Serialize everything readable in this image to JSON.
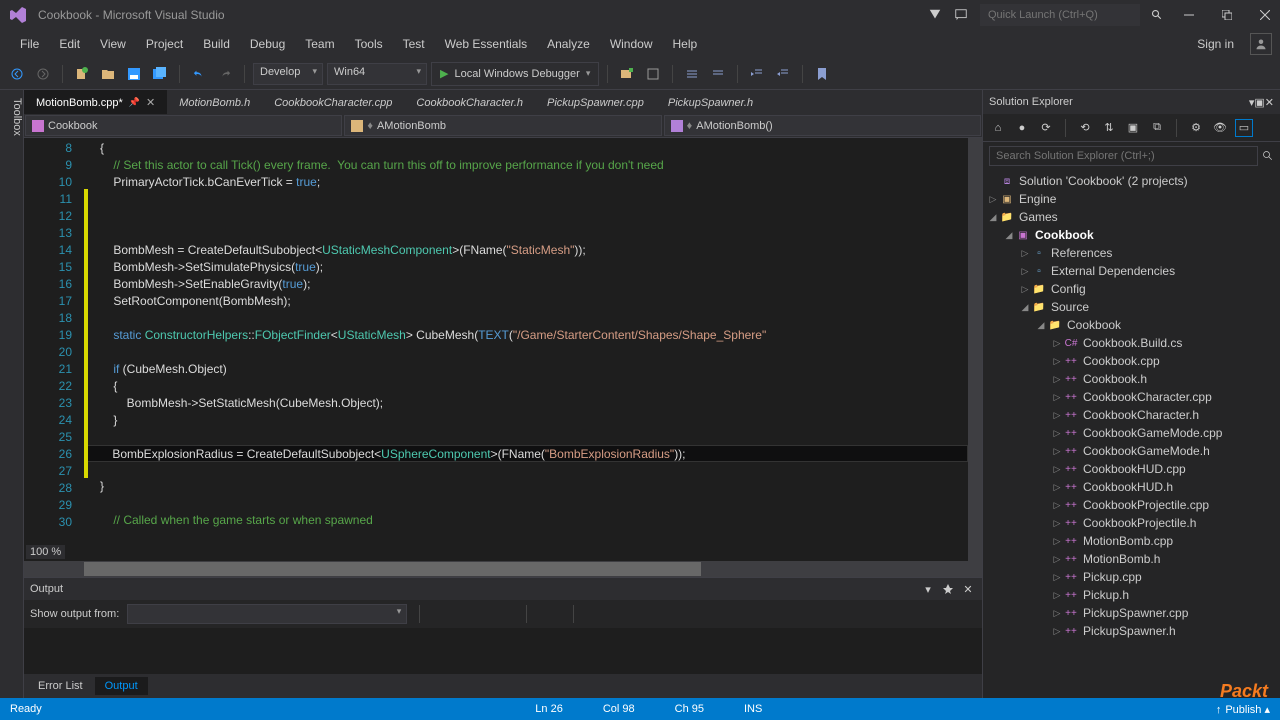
{
  "title": "Cookbook - Microsoft Visual Studio",
  "quickLaunch": {
    "placeholder": "Quick Launch (Ctrl+Q)"
  },
  "signIn": "Sign in",
  "menu": [
    "File",
    "Edit",
    "View",
    "Project",
    "Build",
    "Debug",
    "Team",
    "Tools",
    "Test",
    "Web Essentials",
    "Analyze",
    "Window",
    "Help"
  ],
  "toolbar": {
    "config": "Develop",
    "platform": "Win64",
    "debuggerLabel": "Local Windows Debugger"
  },
  "tabs": [
    {
      "name": "MotionBomb.cpp*",
      "active": true,
      "pinned": true
    },
    {
      "name": "MotionBomb.h",
      "preview": true
    },
    {
      "name": "CookbookCharacter.cpp",
      "preview": true
    },
    {
      "name": "CookbookCharacter.h",
      "preview": true
    },
    {
      "name": "PickupSpawner.cpp",
      "preview": true
    },
    {
      "name": "PickupSpawner.h",
      "preview": true
    }
  ],
  "context": {
    "scope": "Cookbook",
    "class": "AMotionBomb",
    "member": "AMotionBomb()"
  },
  "code": {
    "startLine": 8,
    "endLine": 30,
    "lines": [
      {
        "n": 8,
        "t": "open",
        "txt": "{"
      },
      {
        "n": 9,
        "t": "cmt",
        "txt": "    // Set this actor to call Tick() every frame.  You can turn this off to improve performance if you don't need"
      },
      {
        "n": 10,
        "t": "code",
        "txt": "    PrimaryActorTick.bCanEverTick = ",
        "kw": "true",
        "tail": ";"
      },
      {
        "n": 11,
        "t": "blank",
        "txt": ""
      },
      {
        "n": 12,
        "t": "blank",
        "txt": ""
      },
      {
        "n": 13,
        "t": "blank",
        "txt": ""
      },
      {
        "n": 14,
        "t": "assign",
        "pre": "    BombMesh = CreateDefaultSubobject<",
        "ty": "UStaticMeshComponent",
        "mid": ">(FName(",
        "str": "\"StaticMesh\"",
        "post": "));"
      },
      {
        "n": 15,
        "t": "call",
        "pre": "    BombMesh->SetSimulatePhysics(",
        "kw": "true",
        "post": ");"
      },
      {
        "n": 16,
        "t": "call",
        "pre": "    BombMesh->SetEnableGravity(",
        "kw": "true",
        "post": ");"
      },
      {
        "n": 17,
        "t": "plain",
        "txt": "    SetRootComponent(BombMesh);"
      },
      {
        "n": 18,
        "t": "blank",
        "txt": ""
      },
      {
        "n": 19,
        "t": "static",
        "pre": "    ",
        "kw": "static",
        "mid": " ",
        "ty": "ConstructorHelpers",
        "col": "::",
        "ty2": "FObjectFinder",
        "lt": "<",
        "ty3": "UStaticMesh",
        "gt": "> CubeMesh(",
        "mac": "TEXT",
        "paren": "(",
        "str": "\"/Game/StarterContent/Shapes/Shape_Sphere\"",
        "post": ""
      },
      {
        "n": 20,
        "t": "blank",
        "txt": ""
      },
      {
        "n": 21,
        "t": "if",
        "pre": "    ",
        "kw": "if",
        "post": " (CubeMesh.Object)"
      },
      {
        "n": 22,
        "t": "plain",
        "txt": "    {"
      },
      {
        "n": 23,
        "t": "plain",
        "txt": "        BombMesh->SetStaticMesh(CubeMesh.Object);"
      },
      {
        "n": 24,
        "t": "plain",
        "txt": "    }"
      },
      {
        "n": 25,
        "t": "blank",
        "txt": ""
      },
      {
        "n": 26,
        "t": "assign",
        "pre": "    BombExplosionRadius = CreateDefaultSubobject<",
        "ty": "USphereComponent",
        "mid": ">(FName(",
        "str": "\"BombExplosionRadius\"",
        "post": "));",
        "current": true
      },
      {
        "n": 27,
        "t": "blank",
        "txt": ""
      },
      {
        "n": 28,
        "t": "plain",
        "txt": "}"
      },
      {
        "n": 29,
        "t": "blank",
        "txt": ""
      },
      {
        "n": 30,
        "t": "cmt",
        "txt": "    // Called when the game starts or when spawned"
      }
    ]
  },
  "zoom": "100 %",
  "output": {
    "title": "Output",
    "showFrom": "Show output from:"
  },
  "bottomTabs": {
    "errorList": "Error List",
    "output": "Output"
  },
  "solExp": {
    "title": "Solution Explorer",
    "searchPlaceholder": "Search Solution Explorer (Ctrl+;)",
    "root": "Solution 'Cookbook' (2 projects)",
    "engine": "Engine",
    "games": "Games",
    "cookbook": "Cookbook",
    "refs": "References",
    "ext": "External Dependencies",
    "config": "Config",
    "source": "Source",
    "cookbookSrc": "Cookbook",
    "files": [
      "Cookbook.Build.cs",
      "Cookbook.cpp",
      "Cookbook.h",
      "CookbookCharacter.cpp",
      "CookbookCharacter.h",
      "CookbookGameMode.cpp",
      "CookbookGameMode.h",
      "CookbookHUD.cpp",
      "CookbookHUD.h",
      "CookbookProjectile.cpp",
      "CookbookProjectile.h",
      "MotionBomb.cpp",
      "MotionBomb.h",
      "Pickup.cpp",
      "Pickup.h",
      "PickupSpawner.cpp",
      "PickupSpawner.h"
    ]
  },
  "status": {
    "ready": "Ready",
    "ln": "Ln 26",
    "col": "Col 98",
    "ch": "Ch 95",
    "ins": "INS",
    "publish": "Publish"
  },
  "packt": "Packt"
}
